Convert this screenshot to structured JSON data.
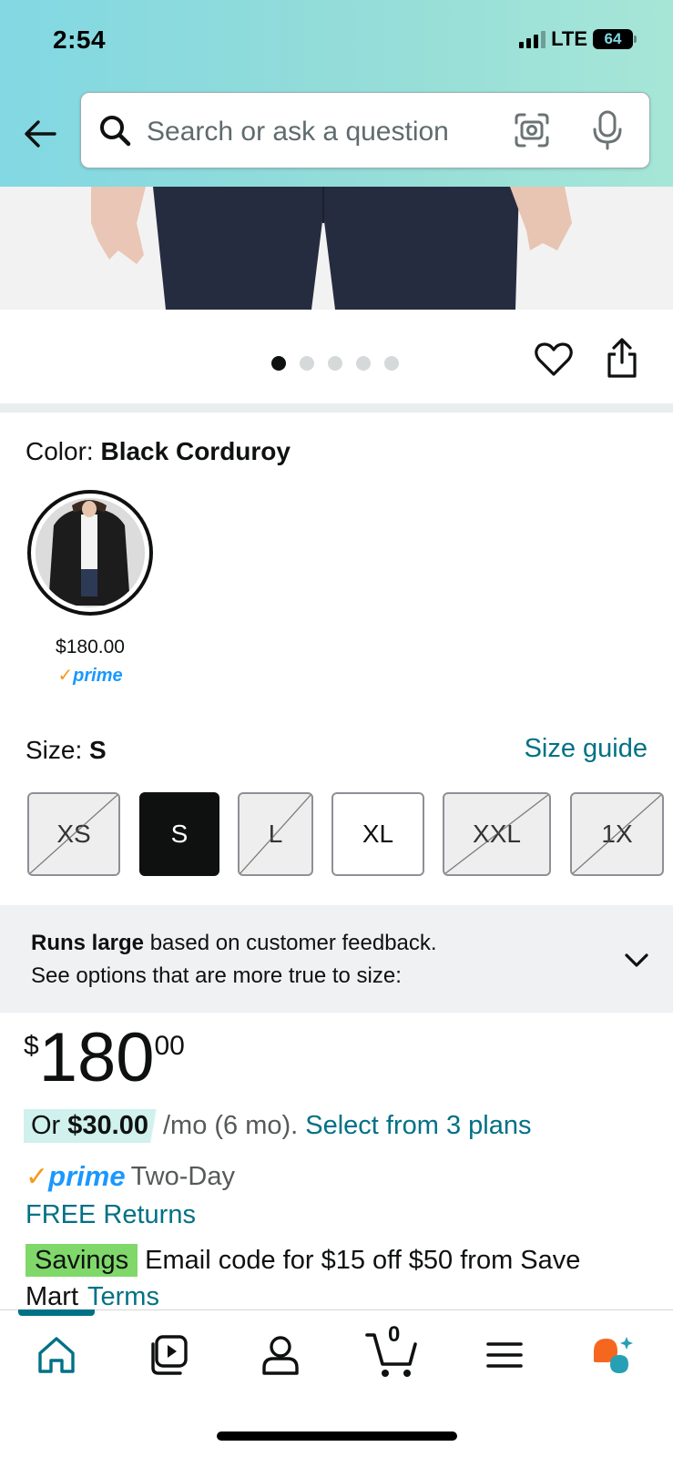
{
  "status_bar": {
    "time": "2:54",
    "network": "LTE",
    "battery": "64"
  },
  "search": {
    "placeholder": "Search or ask a question"
  },
  "carousel": {
    "total_dots": 5,
    "active_index": 0
  },
  "color": {
    "label": "Color:",
    "value": "Black Corduroy",
    "swatch_price": "$180.00",
    "swatch_prime": "prime"
  },
  "size": {
    "label": "Size:",
    "value": "S",
    "guide_link": "Size guide",
    "options": [
      {
        "label": "XS",
        "state": "unavailable"
      },
      {
        "label": "S",
        "state": "selected"
      },
      {
        "label": "L",
        "state": "unavailable"
      },
      {
        "label": "XL",
        "state": "available"
      },
      {
        "label": "XXL",
        "state": "unavailable"
      },
      {
        "label": "1X",
        "state": "unavailable"
      }
    ]
  },
  "fit": {
    "bold": "Runs large",
    "line1_rest": " based on customer feedback.",
    "line2": "See options that are more true to size:"
  },
  "price": {
    "currency": "$",
    "whole": "180",
    "fraction": "00"
  },
  "installment": {
    "prefix": "Or ",
    "amount": "$30.00",
    "term": "/mo (6 mo).",
    "link": "Select from 3 plans"
  },
  "delivery": {
    "prime_check": "✓",
    "prime_word": "prime",
    "speed": "Two-Day",
    "returns": "FREE Returns"
  },
  "savings": {
    "badge": "Savings",
    "text": "Email code for $15 off $50 from Save Mart",
    "terms": "Terms"
  },
  "bottom_nav": {
    "cart_count": "0",
    "items": [
      "home-icon",
      "video-icon",
      "account-icon",
      "cart-icon",
      "menu-icon",
      "rufus-assistant-icon"
    ]
  },
  "colors": {
    "link": "#007185",
    "prime_blue": "#1a98ff",
    "prime_check": "#f49a1b",
    "savings_green": "#7fd869"
  }
}
